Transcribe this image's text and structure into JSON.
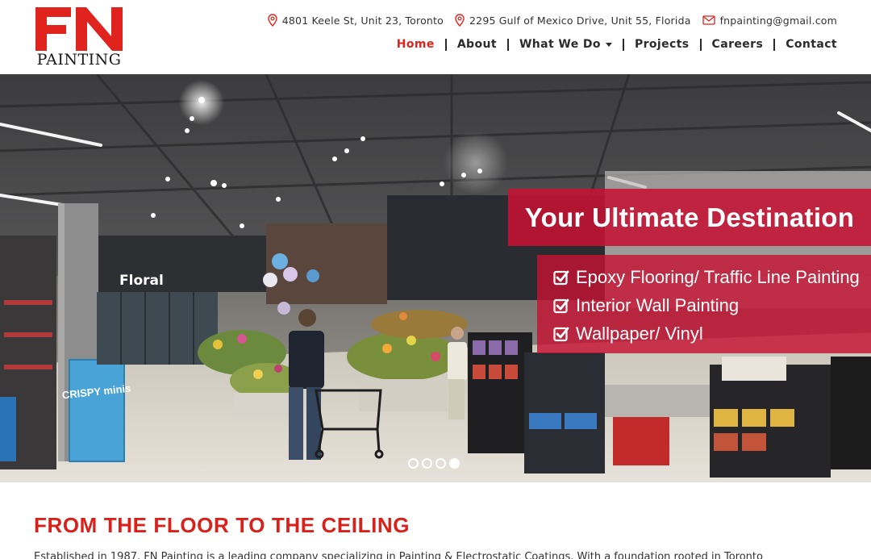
{
  "brand": {
    "logo_letters": "FN",
    "logo_word": "PAINTING",
    "red": "#e0231c"
  },
  "contact": [
    {
      "icon": "map-pin-icon",
      "text": "4801 Keele St, Unit 23, Toronto"
    },
    {
      "icon": "map-pin-icon",
      "text": "2295 Gulf of Mexico Drive, Unit 55, Florida"
    },
    {
      "icon": "mail-icon",
      "text": "fnpainting@gmail.com"
    }
  ],
  "nav": [
    {
      "label": "Home",
      "active": true
    },
    {
      "label": "About"
    },
    {
      "label": "What We Do",
      "dropdown": true
    },
    {
      "label": "Projects"
    },
    {
      "label": "Careers"
    },
    {
      "label": "Contact"
    }
  ],
  "hero": {
    "title": "Your Ultimate Destination",
    "items": [
      "Epoxy Flooring/ Traffic Line Painting",
      "Interior Wall Painting",
      "Wallpaper/ Vinyl"
    ],
    "overlay_color": "#c41232",
    "photo_signs": {
      "floral": "Floral",
      "display": "CRISPY minis"
    },
    "slides": 4,
    "active_slide": 4
  },
  "intro": {
    "title": "FROM THE FLOOR TO THE CEILING",
    "text": "Established in 1987, FN Painting is a leading company specializing in Painting & Electrostatic Coatings. With a foundation rooted in Toronto"
  }
}
